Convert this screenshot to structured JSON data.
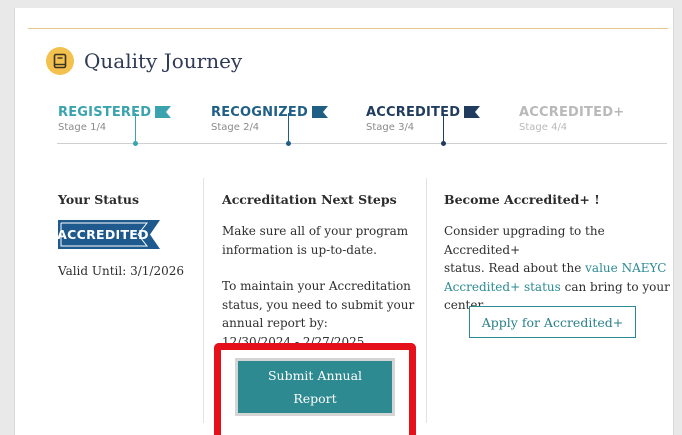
{
  "header": {
    "title": "Quality Journey",
    "icon": "book-icon",
    "icon_color": "#f2c14e"
  },
  "progress": {
    "stages": [
      {
        "name": "REGISTERED",
        "sub": "Stage 1/4",
        "color": "#3aa3ad"
      },
      {
        "name": "RECOGNIZED",
        "sub": "Stage 2/4",
        "color": "#1f5f86"
      },
      {
        "name": "ACCREDITED",
        "sub": "Stage 3/4",
        "color": "#1f3b5e"
      },
      {
        "name": "ACCREDITED+",
        "sub": "Stage 4/4",
        "color": "#b9b9b9"
      }
    ]
  },
  "status": {
    "title": "Your Status",
    "badge": "ACCREDITED",
    "badge_color": "#1e5a8e",
    "valid_until": "Valid Until: 3/1/2026"
  },
  "next_steps": {
    "title": "Accreditation Next Steps",
    "para1_line1": "Make sure all of your program",
    "para1_line2": "information is up-to-date.",
    "para2_line1": "To maintain your Accreditation",
    "para2_line2": "status, you need to submit your",
    "para2_line3": "annual report by:",
    "para2_line4": "12/30/2024 - 2/27/2025",
    "submit_line1": "Submit Annual",
    "submit_line2": "Report"
  },
  "upgrade": {
    "title": "Become Accredited+ !",
    "line1": "Consider upgrading to the Accredited+",
    "line2_pre": "status. Read about the ",
    "line2_link": "value NAEYC",
    "line3_link": "Accredited+ status",
    "line3_post": " can bring to your",
    "line4": "center.",
    "apply_label": "Apply for Accredited+"
  },
  "colors": {
    "accent": "#2e8a91",
    "highlight": "#e5101a"
  }
}
